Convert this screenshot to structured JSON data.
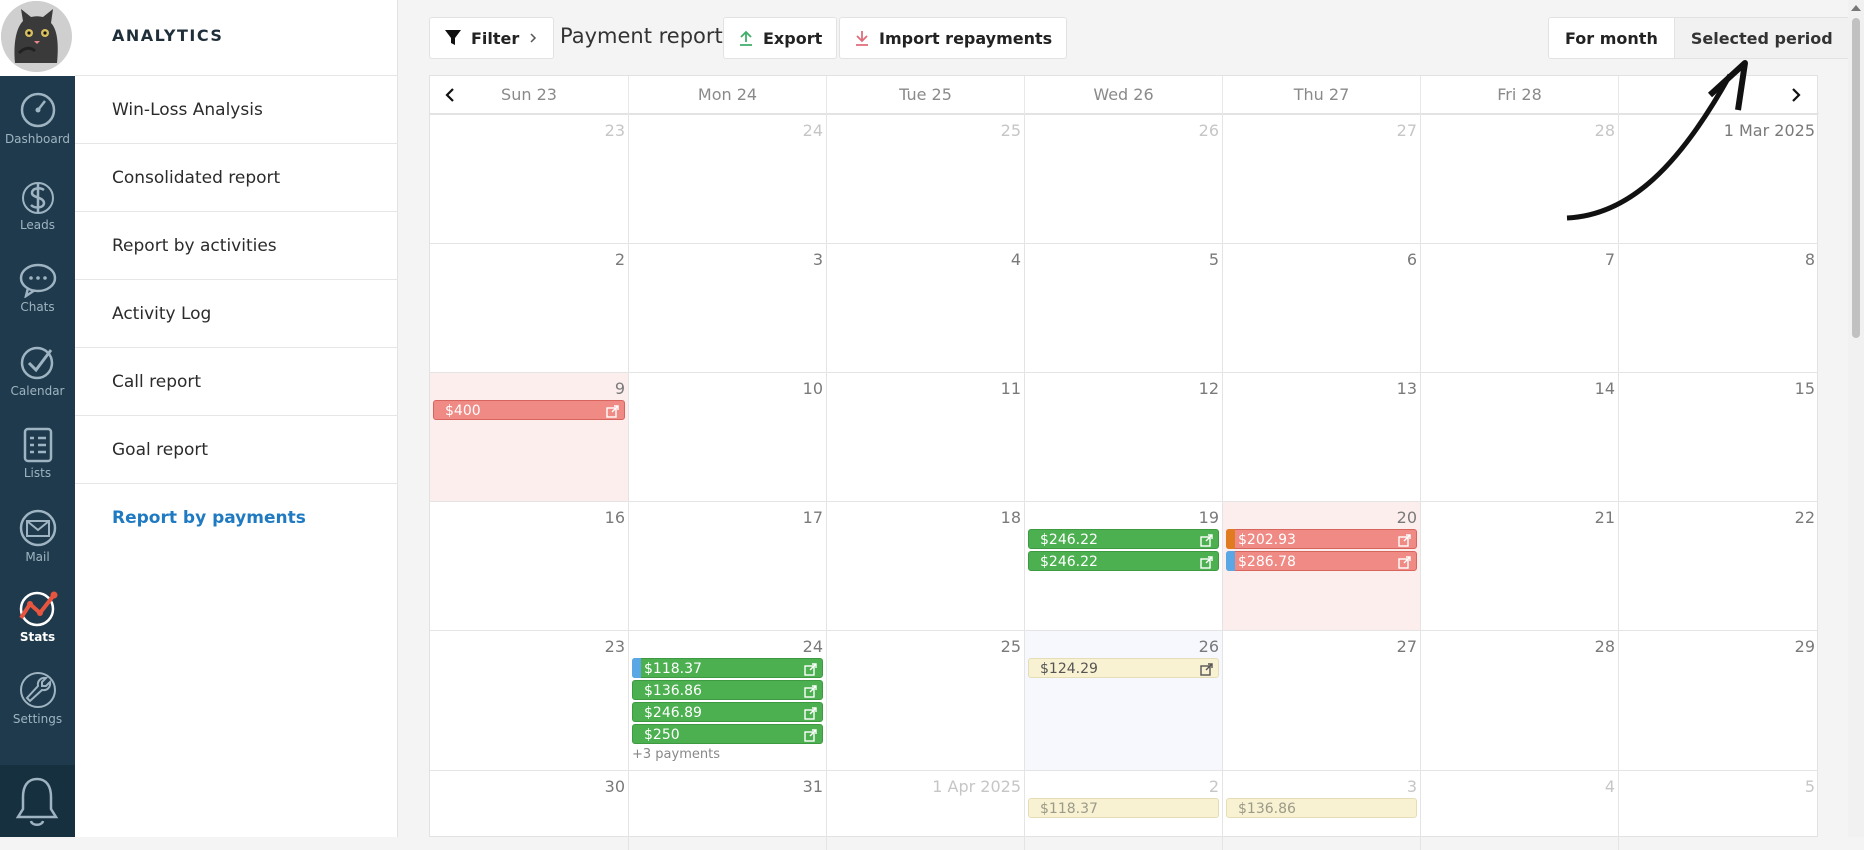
{
  "rail": {
    "items": [
      {
        "label": "Dashboard",
        "icon": "speedometer-icon"
      },
      {
        "label": "Leads",
        "icon": "dollar-icon"
      },
      {
        "label": "Chats",
        "icon": "chat-bubble-icon"
      },
      {
        "label": "Calendar",
        "icon": "checkmark-circle-icon"
      },
      {
        "label": "Lists",
        "icon": "list-icon"
      },
      {
        "label": "Mail",
        "icon": "envelope-icon"
      },
      {
        "label": "Stats",
        "icon": "chart-line-icon"
      },
      {
        "label": "Settings",
        "icon": "wrench-icon"
      }
    ],
    "active": "Stats"
  },
  "menu": {
    "title": "ANALYTICS",
    "items": [
      "Win-Loss Analysis",
      "Consolidated report",
      "Report by activities",
      "Activity Log",
      "Call report",
      "Goal report",
      "Report by payments"
    ],
    "active_index": 6
  },
  "toolbar": {
    "filter_label": "Filter",
    "title": "Payment report",
    "export_label": "Export",
    "import_label": "Import repayments",
    "period_toggle": [
      "For month",
      "Selected period"
    ]
  },
  "calendar": {
    "header_days": [
      "Sun 23",
      "Mon 24",
      "Tue 25",
      "Wed 26",
      "Thu 27",
      "Fri 28",
      ""
    ],
    "weeks": [
      [
        {
          "d": "23",
          "m": true
        },
        {
          "d": "24",
          "m": true
        },
        {
          "d": "25",
          "m": true
        },
        {
          "d": "26",
          "m": true
        },
        {
          "d": "27",
          "m": true
        },
        {
          "d": "28",
          "m": true
        },
        {
          "d": "1 Mar 2025",
          "m": false
        }
      ],
      [
        {
          "d": "2"
        },
        {
          "d": "3"
        },
        {
          "d": "4"
        },
        {
          "d": "5"
        },
        {
          "d": "6"
        },
        {
          "d": "7"
        },
        {
          "d": "8"
        }
      ],
      [
        {
          "d": "9",
          "weekend": true
        },
        {
          "d": "10"
        },
        {
          "d": "11"
        },
        {
          "d": "12"
        },
        {
          "d": "13"
        },
        {
          "d": "14"
        },
        {
          "d": "15"
        }
      ],
      [
        {
          "d": "16"
        },
        {
          "d": "17"
        },
        {
          "d": "18"
        },
        {
          "d": "19"
        },
        {
          "d": "20",
          "weekend": true
        },
        {
          "d": "21"
        },
        {
          "d": "22"
        }
      ],
      [
        {
          "d": "23"
        },
        {
          "d": "24"
        },
        {
          "d": "25"
        },
        {
          "d": "26",
          "today": true
        },
        {
          "d": "27"
        },
        {
          "d": "28"
        },
        {
          "d": "29"
        }
      ],
      [
        {
          "d": "30"
        },
        {
          "d": "31"
        },
        {
          "d": "1 Apr 2025",
          "m": true
        },
        {
          "d": "2",
          "m": true
        },
        {
          "d": "3",
          "m": true
        },
        {
          "d": "4",
          "m": true
        },
        {
          "d": "5",
          "m": true
        }
      ]
    ],
    "events": [
      {
        "week": 2,
        "day": 0,
        "slot": 0,
        "amount": "$400",
        "color": "red"
      },
      {
        "week": 3,
        "day": 3,
        "slot": 0,
        "amount": "$246.22",
        "color": "green"
      },
      {
        "week": 3,
        "day": 3,
        "slot": 1,
        "amount": "$246.22",
        "color": "green"
      },
      {
        "week": 3,
        "day": 4,
        "slot": 0,
        "amount": "$202.93",
        "color": "red",
        "strip": "#e07b1f"
      },
      {
        "week": 3,
        "day": 4,
        "slot": 1,
        "amount": "$286.78",
        "color": "red",
        "strip": "#5aa7e6"
      },
      {
        "week": 4,
        "day": 1,
        "slot": 0,
        "amount": "$118.37",
        "color": "green",
        "strip": "#5aa7e6"
      },
      {
        "week": 4,
        "day": 1,
        "slot": 1,
        "amount": "$136.86",
        "color": "green"
      },
      {
        "week": 4,
        "day": 1,
        "slot": 2,
        "amount": "$246.89",
        "color": "green"
      },
      {
        "week": 4,
        "day": 1,
        "slot": 3,
        "amount": "$250",
        "color": "green"
      },
      {
        "week": 4,
        "day": 3,
        "slot": 0,
        "amount": "$124.29",
        "color": "yellow"
      },
      {
        "week": 5,
        "day": 3,
        "slot": 0,
        "amount": "$118.37",
        "color": "yellow",
        "faded": true,
        "nolink": true
      },
      {
        "week": 5,
        "day": 4,
        "slot": 0,
        "amount": "$136.86",
        "color": "yellow",
        "faded": true,
        "nolink": true
      }
    ],
    "more": {
      "week": 4,
      "day": 1,
      "label": "+3 payments"
    }
  }
}
